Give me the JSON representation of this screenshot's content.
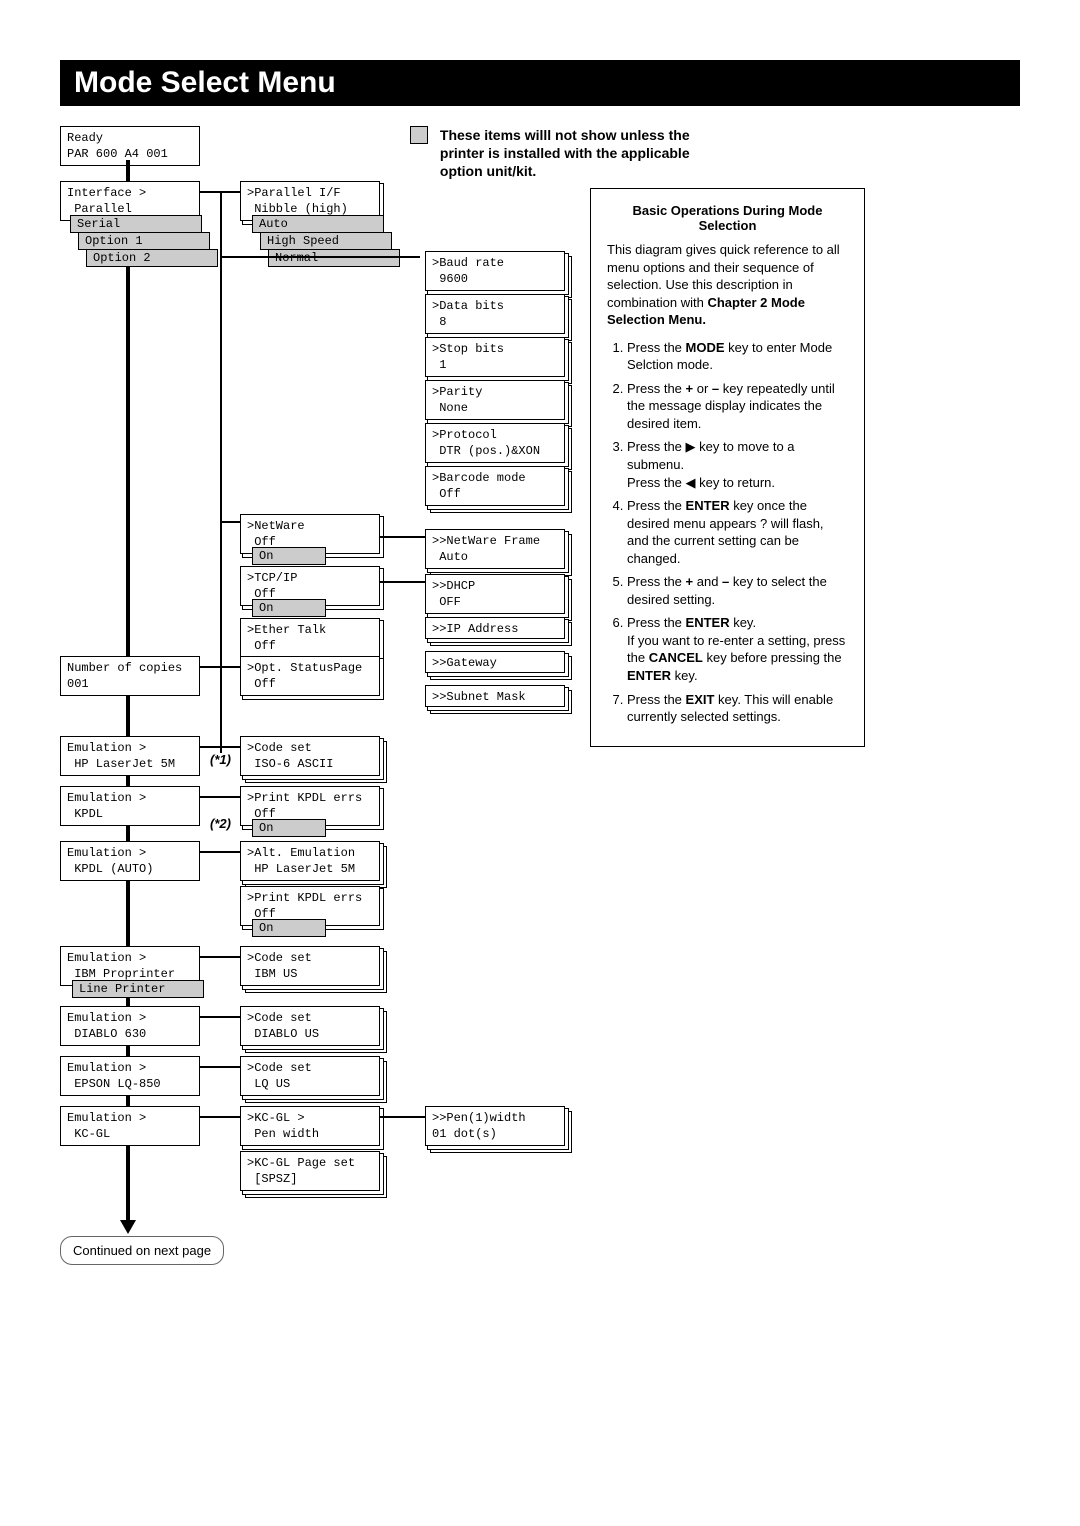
{
  "title": "Mode Select Menu",
  "legend_text": "These items willl not show unless the printer is installed with the applicable option unit/kit.",
  "ready": {
    "l1": "Ready",
    "l2": "PAR    600 A4 001"
  },
  "interface": {
    "label": "Interface        >",
    "v": "Parallel",
    "opts": [
      "Serial",
      "Option 1",
      "Option 2"
    ]
  },
  "parallel": {
    "label": ">Parallel I/F",
    "v": "Nibble (high)",
    "opts": [
      "Auto",
      "High Speed",
      "Normal"
    ]
  },
  "serial_params": [
    {
      "label": ">Baud rate",
      "v": "9600"
    },
    {
      "label": ">Data bits",
      "v": "8"
    },
    {
      "label": ">Stop bits",
      "v": "1"
    },
    {
      "label": ">Parity",
      "v": "None"
    },
    {
      "label": ">Protocol",
      "v": "DTR (pos.)&XON"
    },
    {
      "label": ">Barcode mode",
      "v": "Off"
    }
  ],
  "netware": {
    "label": ">NetWare",
    "v": "Off",
    "on": "On"
  },
  "netware_frame": {
    "label": ">>NetWare Frame",
    "v": "Auto"
  },
  "tcpip": {
    "label": ">TCP/IP",
    "v": "Off",
    "on": "On"
  },
  "dhcp": {
    "label": ">>DHCP",
    "v": "OFF"
  },
  "ip": {
    "label": ">>IP Address"
  },
  "ethertalk": {
    "label": ">Ether Talk",
    "v": "Off"
  },
  "gateway": {
    "label": ">>Gateway"
  },
  "subnet": {
    "label": ">>Subnet Mask"
  },
  "copies": {
    "label": "Number of copies",
    "v": "             001"
  },
  "statuspage": {
    "label": ">Opt. StatusPage",
    "v": "Off"
  },
  "em_hp": {
    "label": "Emulation        >",
    "v": "HP LaserJet 5M"
  },
  "codeset_iso": {
    "label": ">Code set",
    "v": "ISO-6 ASCII"
  },
  "em_kpdl": {
    "label": "Emulation        >",
    "v": "KPDL"
  },
  "kpdl_err": {
    "label": ">Print KPDL errs",
    "v": "Off",
    "on": "On"
  },
  "em_kpdl_auto": {
    "label": "Emulation        >",
    "v": "KPDL (AUTO)"
  },
  "alt_em": {
    "label": ">Alt. Emulation",
    "v": "HP LaserJet 5M"
  },
  "kpdl_err2": {
    "label": ">Print KPDL errs",
    "v": "Off",
    "on": "On"
  },
  "em_ibm": {
    "label": "Emulation        >",
    "v": "IBM Proprinter",
    "lp": "Line Printer"
  },
  "codeset_ibm": {
    "label": ">Code set",
    "v": "IBM US"
  },
  "em_diablo": {
    "label": "Emulation        >",
    "v": "DIABLO 630"
  },
  "codeset_diablo": {
    "label": ">Code set",
    "v": "DIABLO US"
  },
  "em_epson": {
    "label": "Emulation        >",
    "v": "EPSON LQ-850"
  },
  "codeset_lq": {
    "label": ">Code set",
    "v": "LQ US"
  },
  "em_kcgl": {
    "label": "Emulation        >",
    "v": "KC-GL"
  },
  "kcgl": {
    "label": ">KC-GL          >",
    "v": "Pen width"
  },
  "pen": {
    "label": ">>Pen(1)width",
    "v": "        01 dot(s)"
  },
  "kcgl_page": {
    "label": ">KC-GL Page set",
    "v": "[SPSZ]"
  },
  "star1": "(*1)",
  "star2": "(*2)",
  "continued": "Continued on next page",
  "sidebar": {
    "title": "Basic Operations During Mode Selection",
    "intro_a": "This diagram gives quick reference to all menu options and their sequence of selection. Use this description in combination with ",
    "intro_b": "Chapter 2 Mode Selection Menu.",
    "steps": [
      {
        "t": "Press the <b>MODE</b> key to enter Mode Selction mode."
      },
      {
        "t": "Press the <b>+</b> or <b>–</b> key repeatedly until the message display indicates the desired item."
      },
      {
        "t": "Press the &#9654; key to move to a submenu.<br>Press the &#9664; key to return."
      },
      {
        "t": "Press the <b>ENTER</b> key once the desired menu appears ? will flash, and the current setting can be changed."
      },
      {
        "t": "Press the <b>+</b> and <b>–</b> key to select the desired setting."
      },
      {
        "t": "Press the <b>ENTER</b> key.<br>If you want to re-enter a setting, press the <b>CANCEL</b> key before pressing the <b>ENTER</b> key."
      },
      {
        "t": "Press the <b>EXIT</b> key. This will enable currently selected settings."
      }
    ]
  }
}
